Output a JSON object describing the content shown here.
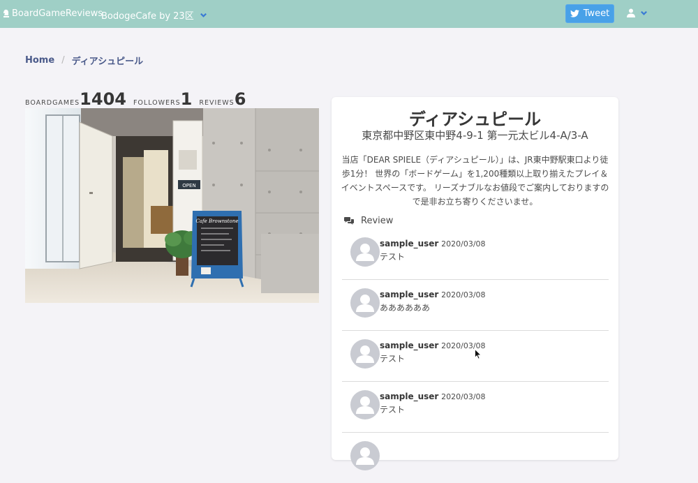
{
  "navbar": {
    "brand": "BoardGameReviews",
    "cafe_menu": "BodogeCafe by 23区",
    "tweet_label": "Tweet"
  },
  "breadcrumb": {
    "home": "Home",
    "separator": "/",
    "current": "ディアシュピール"
  },
  "stats": {
    "boardgames_label": "BOARDGAMES",
    "boardgames_value": "1404",
    "followers_label": "FOLLOWERS",
    "followers_value": "1",
    "reviews_label": "REVIEWS",
    "reviews_value": "6"
  },
  "shop": {
    "name": "ディアシュピール",
    "address": "東京都中野区東中野4-9-1 第一元太ビル4-A/3-A",
    "description": "当店「DEAR SPIELE（ディアシュピール）」は、JR東中野駅東口より徒歩1分！ 世界の「ボードゲーム」を1,200種類以上取り揃えたプレイ＆イベントスペースです。 リーズナブルなお値段でご案内しておりますので是非お立ち寄りくださいませ。",
    "photo_sign_text": "Cafe Brownstone",
    "photo_open_text": "OPEN"
  },
  "review_section": {
    "heading": "Review",
    "items": [
      {
        "user": "sample_user",
        "date": "2020/03/08",
        "body": "テスト"
      },
      {
        "user": "sample_user",
        "date": "2020/03/08",
        "body": "ああああああ"
      },
      {
        "user": "sample_user",
        "date": "2020/03/08",
        "body": "テスト"
      },
      {
        "user": "sample_user",
        "date": "2020/03/08",
        "body": "テスト"
      }
    ]
  },
  "icons": [
    "chess-piece-icon",
    "chevron-down-icon",
    "twitter-icon",
    "user-icon",
    "comments-icon",
    "mouse-cursor-icon"
  ],
  "colors": {
    "navbar": "#9fcfc6",
    "tweet": "#48a1e8",
    "background": "#f4f3f7",
    "link": "#4a5a8a"
  }
}
